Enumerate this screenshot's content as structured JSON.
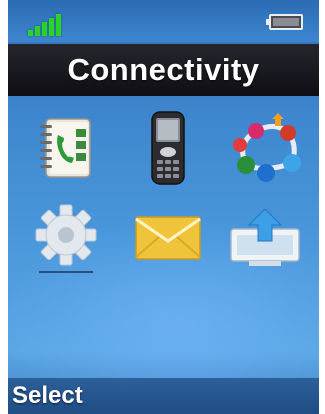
{
  "status": {
    "signal_level": 1.0,
    "signal_icon": "signal-strength-icon",
    "battery_icon": "battery-icon"
  },
  "header": {
    "title": "Connectivity"
  },
  "menu": {
    "items": [
      {
        "icon": "phonebook-icon"
      },
      {
        "icon": "handset-icon"
      },
      {
        "icon": "network-icon"
      },
      {
        "icon": "settings-gear-icon"
      },
      {
        "icon": "message-envelope-icon"
      },
      {
        "icon": "upload-connection-icon"
      }
    ]
  },
  "softkeys": {
    "left": "Select"
  },
  "colors": {
    "background": "#4b98dc",
    "title_bar": "#15151b",
    "signal": "#29d329",
    "envelope": "#f0c43a",
    "gear": "#dfe6ee"
  }
}
